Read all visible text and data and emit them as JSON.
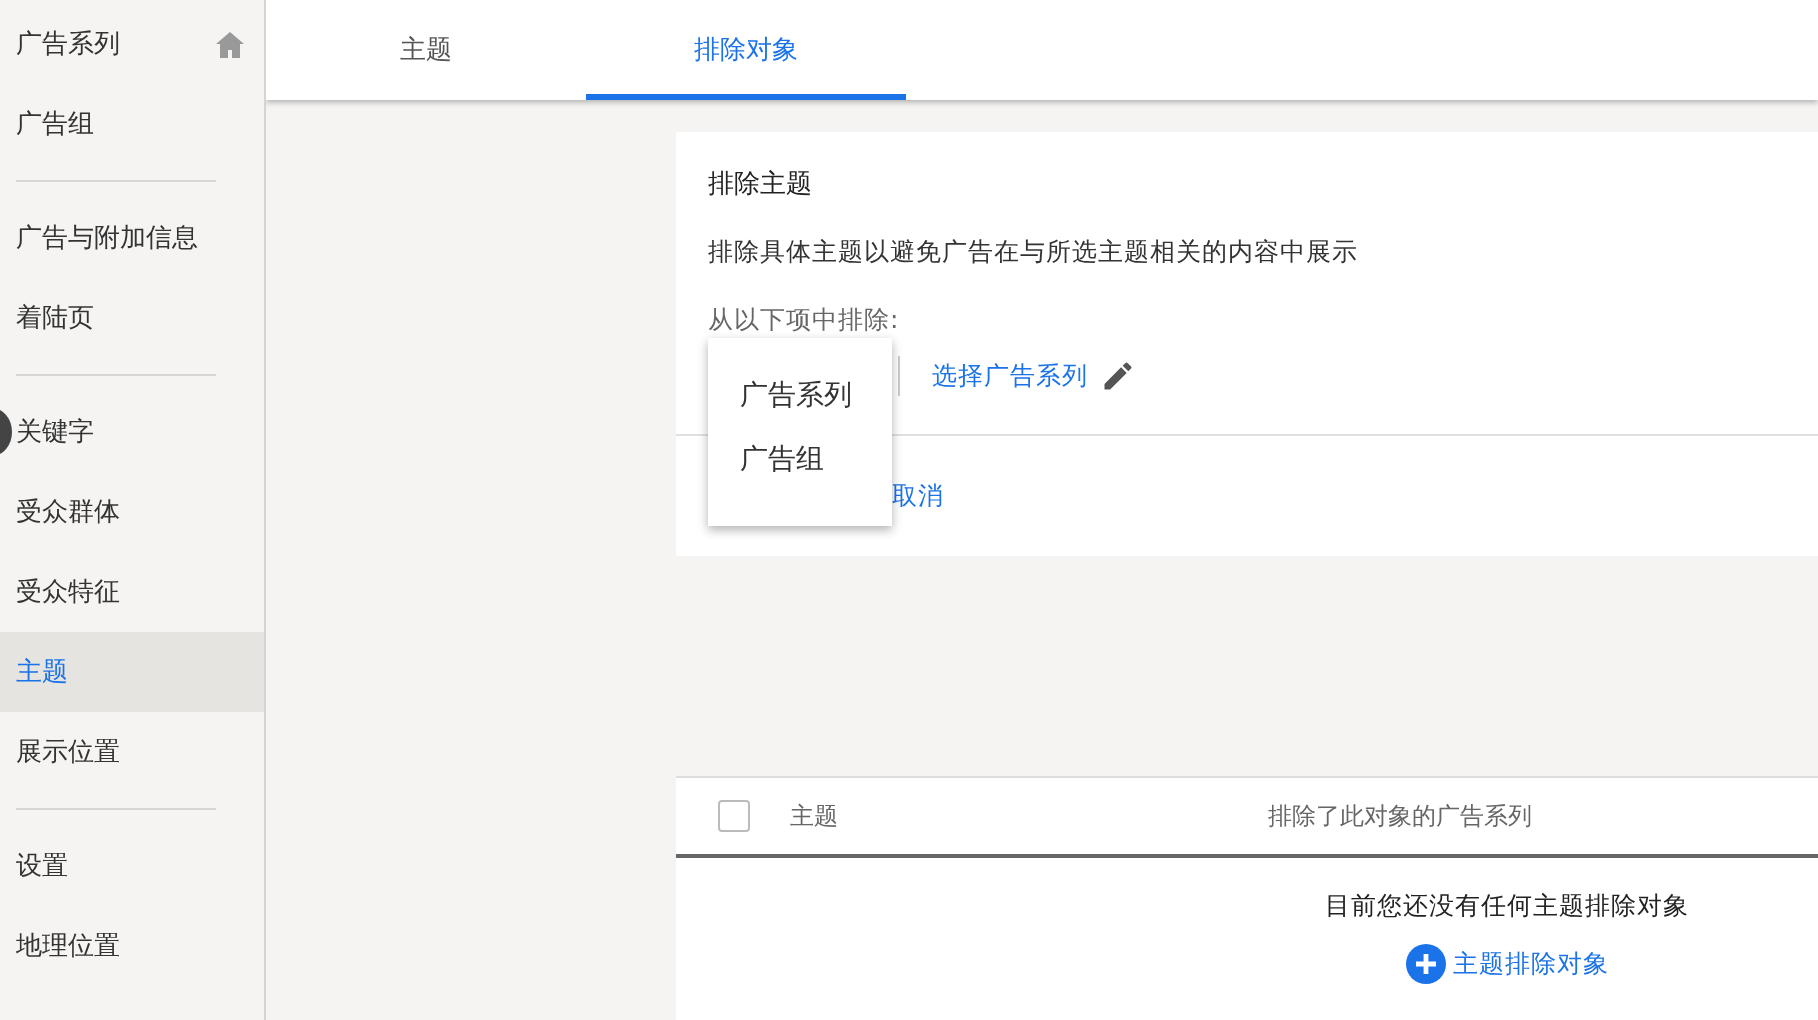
{
  "sidebar": {
    "sections": [
      {
        "items": [
          {
            "label": "广告系列",
            "selected": false,
            "home": true
          },
          {
            "label": "广告组",
            "selected": false,
            "home": false
          }
        ]
      },
      {
        "items": [
          {
            "label": "广告与附加信息",
            "selected": false,
            "home": false
          },
          {
            "label": "着陆页",
            "selected": false,
            "home": false
          }
        ]
      },
      {
        "items": [
          {
            "label": "关键字",
            "selected": false,
            "home": false
          },
          {
            "label": "受众群体",
            "selected": false,
            "home": false
          },
          {
            "label": "受众特征",
            "selected": false,
            "home": false
          },
          {
            "label": "主题",
            "selected": true,
            "home": false
          },
          {
            "label": "展示位置",
            "selected": false,
            "home": false
          }
        ]
      },
      {
        "items": [
          {
            "label": "设置",
            "selected": false,
            "home": false
          },
          {
            "label": "地理位置",
            "selected": false,
            "home": false
          }
        ]
      }
    ]
  },
  "tabs": [
    {
      "label": "主题",
      "selected": false
    },
    {
      "label": "排除对象",
      "selected": true
    }
  ],
  "exclusion_card": {
    "title": "排除主题",
    "description": "排除具体主题以避免广告在与所选主题相关的内容中展示",
    "from_label": "从以下项中排除:",
    "select_link": "选择广告系列",
    "cancel": "取消",
    "menu": [
      {
        "label": "广告系列"
      },
      {
        "label": "广告组"
      }
    ]
  },
  "table": {
    "columns": [
      "主题",
      "排除了此对象的广告系列"
    ],
    "header_checked": false,
    "empty_message": "目前您还没有任何主题排除对象",
    "add_link": "主题排除对象"
  }
}
